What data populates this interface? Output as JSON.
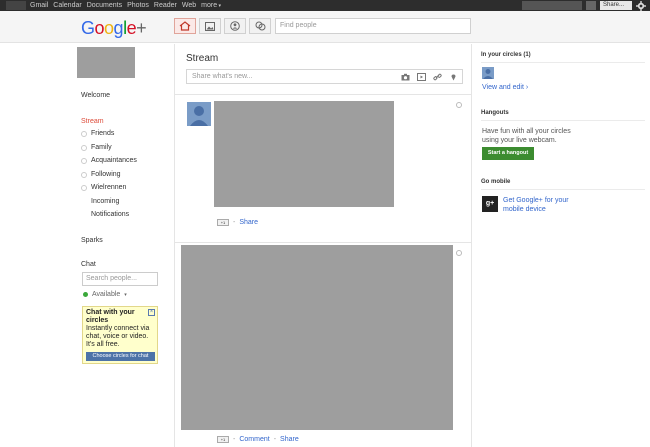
{
  "topbar": {
    "links": [
      "Gmail",
      "Calendar",
      "Documents",
      "Photos",
      "Reader",
      "Web",
      "more"
    ],
    "share_label": "Share..."
  },
  "header": {
    "logo_text": "Google+",
    "find_people_placeholder": "Find people"
  },
  "left": {
    "welcome": "Welcome",
    "stream": "Stream",
    "circles": [
      "Friends",
      "Family",
      "Acquaintances",
      "Following",
      "Wielrennen"
    ],
    "incoming": "Incoming",
    "notifications": "Notifications",
    "sparks": "Sparks",
    "chat": "Chat",
    "chat_search_placeholder": "Search people...",
    "available": "Available",
    "promo": {
      "title": "Chat with your circles",
      "desc": "Instantly connect via chat, voice or video. It's all free.",
      "button": "Choose circles for chat"
    }
  },
  "center": {
    "title": "Stream",
    "share_placeholder": "Share what's new...",
    "post1": {
      "plus": "+1",
      "actions": [
        "Share"
      ]
    },
    "post2": {
      "plus": "+1",
      "actions": [
        "Comment",
        "Share"
      ]
    }
  },
  "right": {
    "in_circles_title": "In your circles (1)",
    "view_edit": "View and edit ›",
    "hangouts_title": "Hangouts",
    "hangouts_desc": "Have fun with all your circles using your live webcam.",
    "hangout_button": "Start a hangout",
    "go_mobile_title": "Go mobile",
    "go_mobile_text": "Get Google+ for your mobile device"
  },
  "colors": {
    "accent_red": "#dd4b39",
    "link_blue": "#3366cc",
    "hangout_green": "#3c8c30"
  }
}
